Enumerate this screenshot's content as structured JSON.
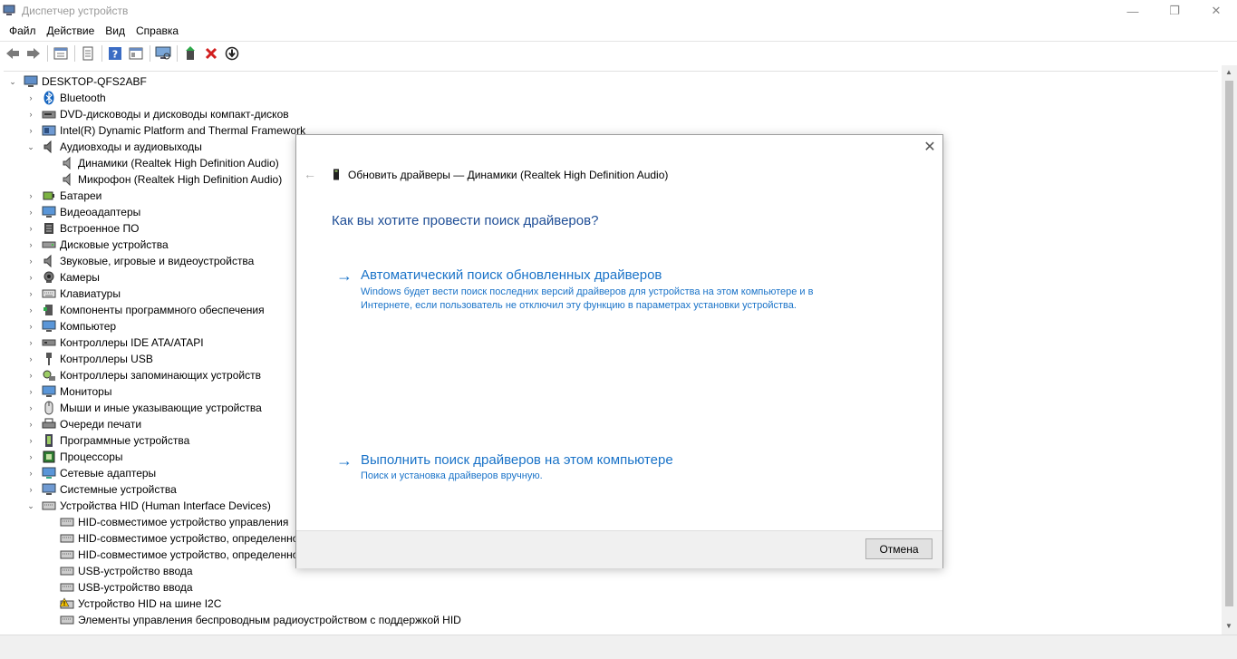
{
  "window": {
    "title": "Диспетчер устройств",
    "minimize": "—",
    "maximize": "❐",
    "close": "✕"
  },
  "menu": [
    "Файл",
    "Действие",
    "Вид",
    "Справка"
  ],
  "tree": {
    "root": "DESKTOP-QFS2ABF",
    "items": [
      "Bluetooth",
      "DVD-дисководы и дисководы компакт-дисков",
      "Intel(R) Dynamic Platform and Thermal Framework",
      "Аудиовходы и аудиовыходы",
      "Динамики (Realtek High Definition Audio)",
      "Микрофон (Realtek High Definition Audio)",
      "Батареи",
      "Видеоадаптеры",
      "Встроенное ПО",
      "Дисковые устройства",
      "Звуковые, игровые и видеоустройства",
      "Камеры",
      "Клавиатуры",
      "Компоненты программного обеспечения",
      "Компьютер",
      "Контроллеры IDE ATA/ATAPI",
      "Контроллеры USB",
      "Контроллеры запоминающих устройств",
      "Мониторы",
      "Мыши и иные указывающие устройства",
      "Очереди печати",
      "Программные устройства",
      "Процессоры",
      "Сетевые адаптеры",
      "Системные устройства",
      "Устройства HID (Human Interface Devices)",
      "HID-совместимое устройство управления",
      "HID-совместимое устройство, определенно",
      "HID-совместимое устройство, определенно",
      "USB-устройство ввода",
      "USB-устройство ввода",
      "Устройство HID на шине I2C",
      "Элементы управления беспроводным радиоустройством с поддержкой HID"
    ]
  },
  "dialog": {
    "close": "✕",
    "back": "←",
    "title": "Обновить драйверы — Динамики (Realtek High Definition Audio)",
    "question": "Как вы хотите провести поиск драйверов?",
    "option1": {
      "arrow": "→",
      "title": "Автоматический поиск обновленных драйверов",
      "desc_line1": "Windows будет вести поиск последних версий драйверов для устройства на этом компьютере и в",
      "desc_line2": "Интернете, если пользователь не отключил эту функцию в параметрах установки устройства."
    },
    "option2": {
      "arrow": "→",
      "title": "Выполнить поиск драйверов на этом компьютере",
      "desc": "Поиск и установка драйверов вручную."
    },
    "cancel": "Отмена"
  },
  "colors": {
    "link": "#1a73c8",
    "heading": "#1f4e96"
  }
}
